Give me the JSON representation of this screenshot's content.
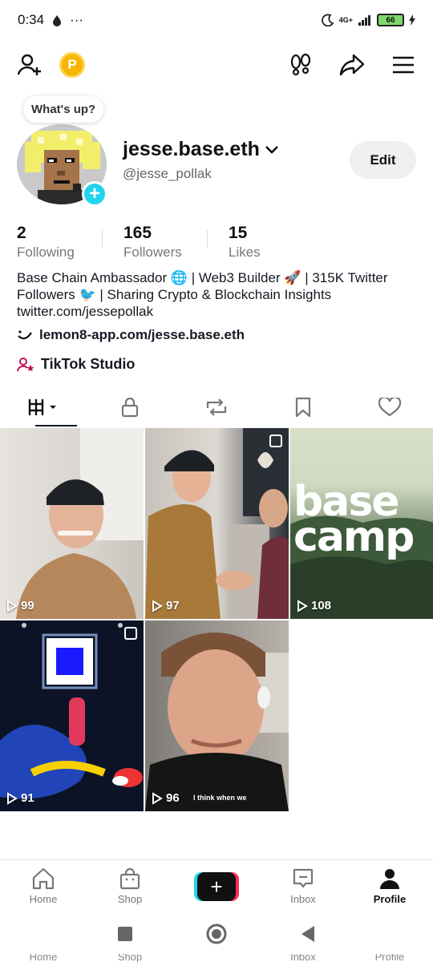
{
  "status_bar": {
    "time": "0:34",
    "dots": "···",
    "network": "4G+",
    "battery": "66"
  },
  "profile": {
    "bubble_text": "What's up?",
    "username": "jesse.base.eth",
    "handle": "@jesse_pollak",
    "edit_label": "Edit",
    "stats": [
      {
        "value": "2",
        "label": "Following"
      },
      {
        "value": "165",
        "label": "Followers"
      },
      {
        "value": "15",
        "label": "Likes"
      }
    ],
    "bio_line1": "Base Chain Ambassador 🌐 | Web3 Builder 🚀 | 315K Twitter",
    "bio_line2": "Followers 🐦 | Sharing Crypto & Blockchain Insights",
    "bio_line3": "twitter.com/jessepollak",
    "link": "lemon8-app.com/jesse.base.eth",
    "studio": "TikTok Studio"
  },
  "videos": [
    {
      "views": "99"
    },
    {
      "views": "97"
    },
    {
      "views": "108",
      "overlay": "base camp"
    },
    {
      "views": "91"
    },
    {
      "views": "96",
      "caption": "I think when we"
    }
  ],
  "bottom_nav": [
    {
      "label": "Home"
    },
    {
      "label": "Shop"
    },
    {
      "label": ""
    },
    {
      "label": "Inbox"
    },
    {
      "label": "Profile"
    }
  ],
  "colors": {
    "accent_cyan": "#20d5ec",
    "accent_red": "#fe2c55",
    "coin": "#f7b500"
  }
}
